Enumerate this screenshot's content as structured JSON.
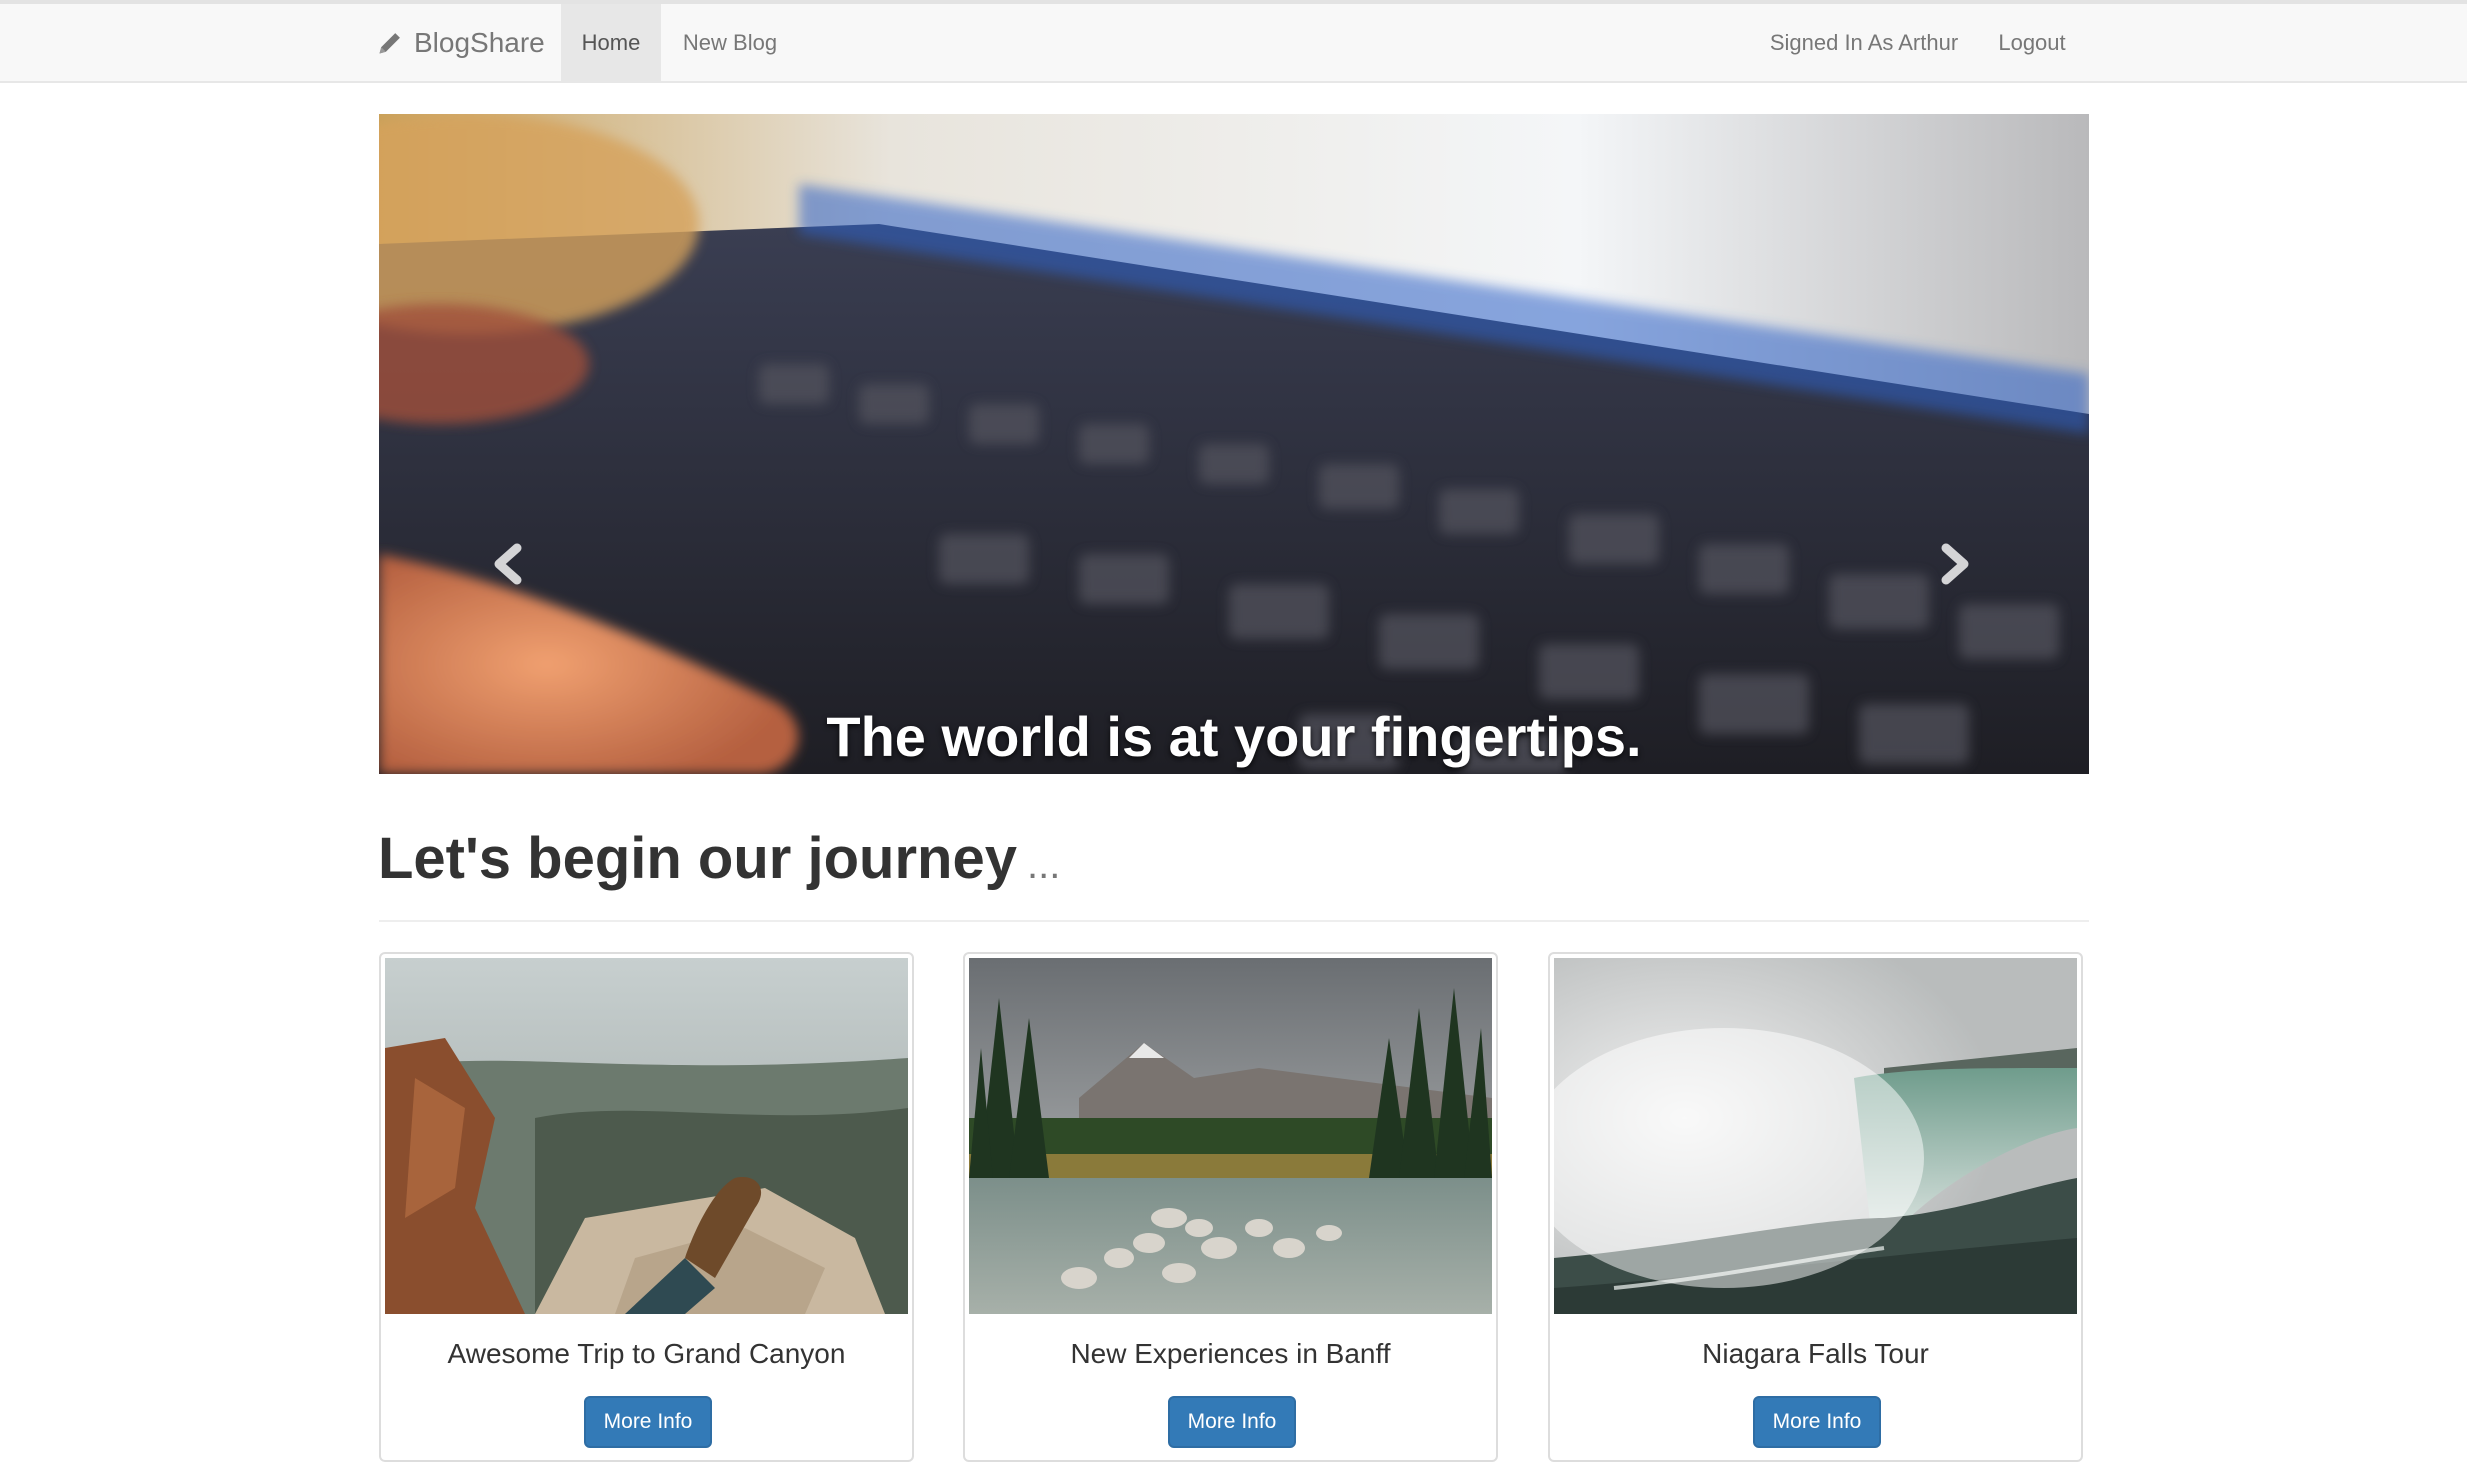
{
  "navbar": {
    "brand": "BlogShare",
    "brand_icon": "pencil-icon",
    "items": [
      {
        "label": "Home",
        "active": true
      },
      {
        "label": "New Blog",
        "active": false
      }
    ],
    "right_items": [
      {
        "label": "Signed In As Arthur"
      },
      {
        "label": "Logout"
      }
    ]
  },
  "carousel": {
    "caption": "The world is at your fingertips.",
    "prev_icon": "chevron-left-icon",
    "next_icon": "chevron-right-icon",
    "slide_count": 3,
    "active_slide": 1
  },
  "section": {
    "heading": "Let's begin our journey",
    "ellipsis": "..."
  },
  "cards": [
    {
      "title": "Awesome Trip to Grand Canyon",
      "button": "More Info"
    },
    {
      "title": "New Experiences in Banff",
      "button": "More Info"
    },
    {
      "title": "Niagara Falls Tour",
      "button": "More Info"
    }
  ],
  "colors": {
    "primary_button": "#337ab7",
    "navbar_bg": "#f8f8f8",
    "active_nav_bg": "#e7e7e7"
  }
}
